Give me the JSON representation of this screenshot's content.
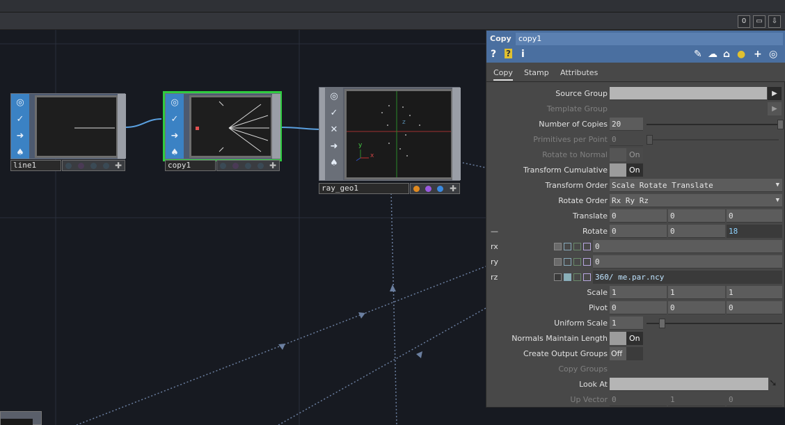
{
  "toolbar": {
    "btn_zero": "0",
    "btn_window": "▭",
    "btn_down": "⇩"
  },
  "nodes": {
    "line1": {
      "label": "line1"
    },
    "copy1": {
      "label": "copy1"
    },
    "ray_geo1": {
      "label": "ray_geo1"
    }
  },
  "viewport_axes": {
    "y": "y",
    "z": "z",
    "x": "x"
  },
  "panel": {
    "op_type": "Copy",
    "op_name": "copy1",
    "icons": {
      "help": "?",
      "python_help": "?",
      "info": "i"
    },
    "tabs": [
      "Copy",
      "Stamp",
      "Attributes"
    ],
    "params": {
      "source_group": {
        "label": "Source Group",
        "value": ""
      },
      "template_group": {
        "label": "Template Group"
      },
      "number_of_copies": {
        "label": "Number of Copies",
        "value": "20"
      },
      "primitives_per_point": {
        "label": "Primitives per Point",
        "value": "0"
      },
      "rotate_to_normal": {
        "label": "Rotate to Normal",
        "value": "On"
      },
      "transform_cumulative": {
        "label": "Transform Cumulative",
        "value": "On"
      },
      "transform_order": {
        "label": "Transform Order",
        "value": "Scale Rotate Translate"
      },
      "rotate_order": {
        "label": "Rotate Order",
        "value": "Rx Ry Rz"
      },
      "translate": {
        "label": "Translate",
        "x": "0",
        "y": "0",
        "z": "0"
      },
      "rotate": {
        "label": "Rotate",
        "collapse": "—",
        "x": "0",
        "y": "0",
        "z": "18"
      },
      "rx": {
        "label": "rx",
        "value": "0"
      },
      "ry": {
        "label": "ry",
        "value": "0"
      },
      "rz": {
        "label": "rz",
        "value": "360/ me.par.ncy"
      },
      "scale": {
        "label": "Scale",
        "x": "1",
        "y": "1",
        "z": "1"
      },
      "pivot": {
        "label": "Pivot",
        "x": "0",
        "y": "0",
        "z": "0"
      },
      "uniform_scale": {
        "label": "Uniform Scale",
        "value": "1"
      },
      "normals_maintain_length": {
        "label": "Normals Maintain Length",
        "value": "On"
      },
      "create_output_groups": {
        "label": "Create Output Groups",
        "value": "Off"
      },
      "copy_groups": {
        "label": "Copy Groups"
      },
      "look_at": {
        "label": "Look At",
        "value": ""
      },
      "up_vector": {
        "label": "Up Vector",
        "x": "0",
        "y": "1",
        "z": "0"
      }
    }
  }
}
